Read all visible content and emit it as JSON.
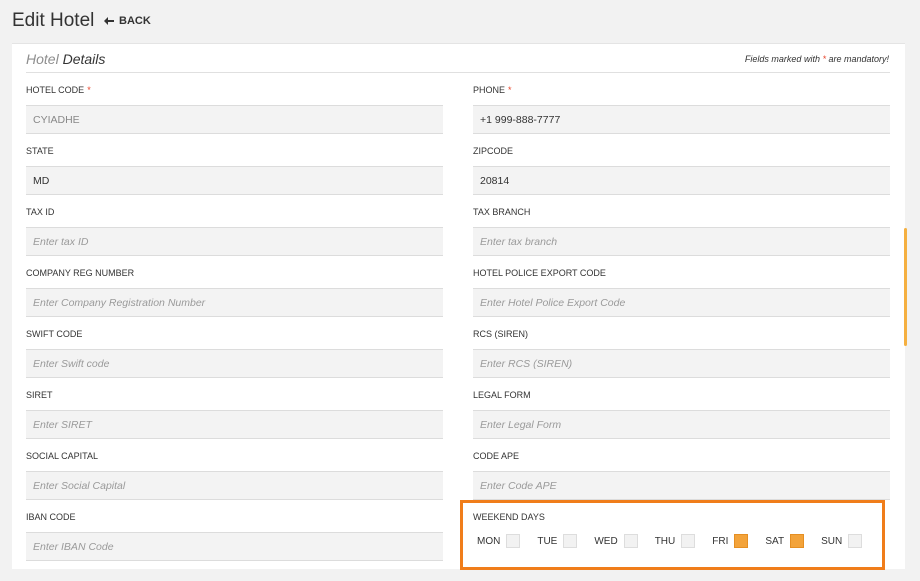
{
  "header": {
    "title": "Edit Hotel",
    "back_label": "BACK"
  },
  "section": {
    "title_light": "Hotel",
    "title_strong": "Details",
    "mandatory_prefix": "Fields marked with ",
    "mandatory_star": "*",
    "mandatory_suffix": " are mandatory!"
  },
  "fields": {
    "hotel_code": {
      "label": "HOTEL CODE",
      "value": "CYIADHE",
      "required": "*"
    },
    "phone": {
      "label": "PHONE",
      "value": "+1 999-888-7777",
      "required": "*"
    },
    "state": {
      "label": "STATE",
      "value": "MD"
    },
    "zipcode": {
      "label": "ZIPCODE",
      "value": "20814"
    },
    "tax_id": {
      "label": "TAX ID",
      "placeholder": "Enter tax ID"
    },
    "tax_branch": {
      "label": "TAX BRANCH",
      "placeholder": "Enter tax branch"
    },
    "company_reg": {
      "label": "COMPANY REG NUMBER",
      "placeholder": "Enter Company Registration Number"
    },
    "police_export": {
      "label": "HOTEL POLICE EXPORT CODE",
      "placeholder": "Enter Hotel Police Export Code"
    },
    "swift": {
      "label": "SWIFT CODE",
      "placeholder": "Enter Swift code"
    },
    "rcs": {
      "label": "RCS (SIREN)",
      "placeholder": "Enter RCS (SIREN)"
    },
    "siret": {
      "label": "SIRET",
      "placeholder": "Enter SIRET"
    },
    "legal_form": {
      "label": "LEGAL FORM",
      "placeholder": "Enter Legal Form"
    },
    "social_capital": {
      "label": "SOCIAL CAPITAL",
      "placeholder": "Enter Social Capital"
    },
    "code_ape": {
      "label": "CODE APE",
      "placeholder": "Enter Code APE"
    },
    "iban": {
      "label": "IBAN CODE",
      "placeholder": "Enter IBAN Code"
    }
  },
  "weekend": {
    "label": "WEEKEND DAYS",
    "days": [
      {
        "label": "MON",
        "checked": false
      },
      {
        "label": "TUE",
        "checked": false
      },
      {
        "label": "WED",
        "checked": false
      },
      {
        "label": "THU",
        "checked": false
      },
      {
        "label": "FRI",
        "checked": true
      },
      {
        "label": "SAT",
        "checked": true
      },
      {
        "label": "SUN",
        "checked": false
      }
    ]
  },
  "colors": {
    "accent": "#f3a33a",
    "highlight_border": "#f07d1a",
    "required_star": "#e8452c"
  },
  "icons": {
    "back": "arrow-left-icon"
  }
}
